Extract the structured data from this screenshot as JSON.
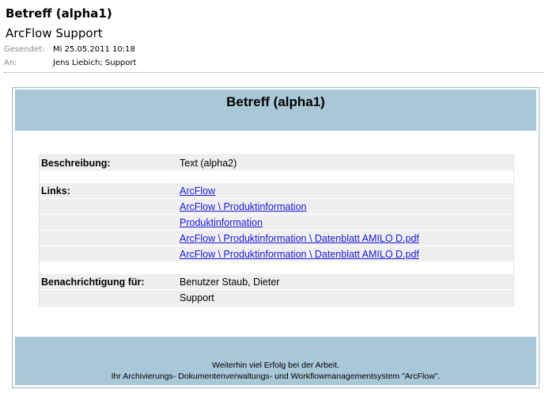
{
  "header": {
    "subject": "Betreff (alpha1)",
    "sender": "ArcFlow Support",
    "sent_label": "Gesendet:",
    "sent_value": "Mi 25.05.2011 10:18",
    "to_label": "An:",
    "to_value": "Jens Liebich; Support"
  },
  "body": {
    "banner_title": "Betreff (alpha1)",
    "description_label": "Beschreibung:",
    "description_value": "Text (alpha2)",
    "links_label": "Links:",
    "links": [
      "ArcFlow",
      "ArcFlow \\ Produktinformation",
      "Produktinformation",
      "ArcFlow \\ Produktinformation \\ Datenblatt AMILO D.pdf",
      "ArcFlow \\ Produktinformation \\ Datenblatt AMILO D.pdf"
    ],
    "notify_label": "Benachrichtigung für:",
    "notify_values": [
      "Benutzer Staub, Dieter",
      "Support"
    ],
    "footer_line1": "Weiterhin viel Erfolg bei der Arbeit.",
    "footer_line2": "Ihr Archivierungs- Dokumentenverwaltungs- und Workflowmanagementsystem \"ArcFlow\"."
  },
  "colors": {
    "banner": "#a8c8d8",
    "row_shade": "#efefef",
    "link": "#1a1ad6",
    "meta_label": "#8a8a8a"
  }
}
